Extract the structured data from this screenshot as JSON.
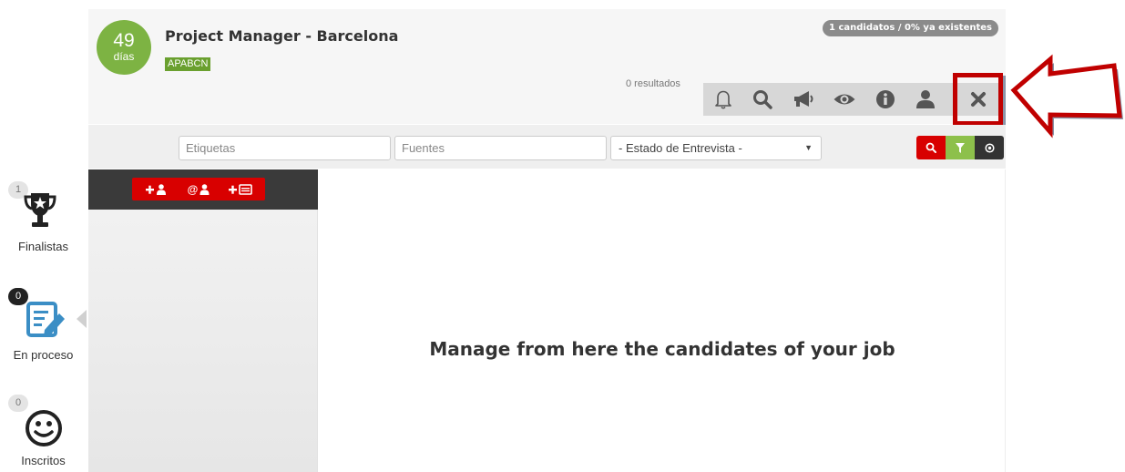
{
  "job": {
    "days_number": "49",
    "days_unit": "días",
    "title": "Project Manager - Barcelona",
    "tag": "APABCN",
    "candidates_summary": "1 candidatos / 0% ya existentes",
    "results": "0 resultados"
  },
  "toolbar": {
    "icons": [
      "bell-icon",
      "search-icon",
      "megaphone-icon",
      "eye-icon",
      "info-icon",
      "user-icon",
      "close-icon"
    ]
  },
  "filters": {
    "tags_placeholder": "Etiquetas",
    "sources_placeholder": "Fuentes",
    "interview_status": "- Estado de Entrevista -"
  },
  "stages": [
    {
      "count": "1",
      "label": "Finalistas",
      "icon": "trophy-icon"
    },
    {
      "count": "0",
      "label": "En proceso",
      "icon": "edit-document-icon"
    },
    {
      "count": "0",
      "label": "Inscritos",
      "icon": "smiley-icon"
    }
  ],
  "main": {
    "empty_message": "Manage from here the candidates of your job"
  },
  "colors": {
    "accent_green": "#7db343",
    "tag_green": "#6aa02f",
    "danger_red": "#d80000",
    "highlight_red": "#c00000",
    "icon_blue": "#3b8ec5"
  }
}
